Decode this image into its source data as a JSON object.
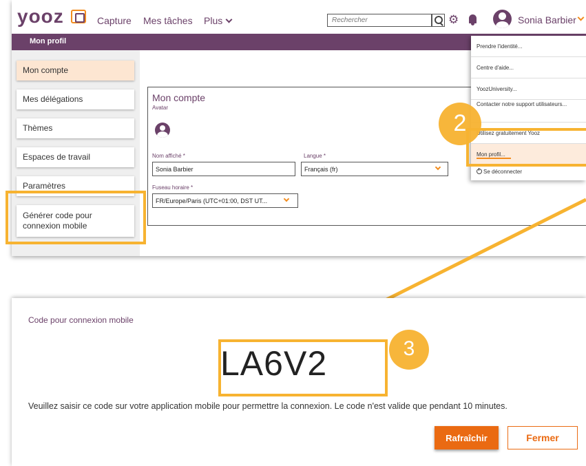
{
  "topnav": {
    "logo": "yooz",
    "links": [
      "Capture",
      "Mes tâches",
      "Plus"
    ],
    "search_placeholder": "Rechercher",
    "user_name": "Sonia Barbier"
  },
  "titlebar": {
    "title": "Mon profil"
  },
  "sidebar": {
    "items": [
      {
        "label": "Mon compte"
      },
      {
        "label": "Mes délégations"
      },
      {
        "label": "Thèmes"
      },
      {
        "label": "Espaces de travail"
      },
      {
        "label": "Paramètres"
      },
      {
        "label": "Générer code pour connexion mobile"
      }
    ]
  },
  "account": {
    "title": "Mon compte",
    "avatar_label": "Avatar",
    "display_name_label": "Nom affiché *",
    "display_name_value": "Sonia Barbier",
    "language_label": "Langue *",
    "language_value": "Français (fr)",
    "timezone_label": "Fuseau horaire *",
    "timezone_value": "FR/Europe/Paris (UTC+01:00, DST UT..."
  },
  "user_menu": {
    "items": [
      {
        "label": "Prendre l'identité..."
      },
      {
        "label": "Centre d'aide..."
      },
      {
        "label": "YoozUniversity..."
      },
      {
        "label": "Contacter notre support utilisateurs..."
      },
      {
        "label": "Utilisez gratuitement Yooz"
      },
      {
        "label": "Mon profil..."
      },
      {
        "label": "Se déconnecter"
      }
    ]
  },
  "steps": {
    "step2": "2",
    "step3": "3"
  },
  "mobile_code": {
    "title": "Code pour connexion mobile",
    "code": "LA6V2",
    "description": "Veuillez saisir ce code sur votre application mobile pour permettre la connexion. Le code n'est valide que pendant 10 minutes.",
    "refresh_label": "Rafraîchir",
    "close_label": "Fermer"
  },
  "colors": {
    "brand_purple": "#6b4169",
    "accent_orange": "#ea6a12",
    "highlight_yellow": "#f7b331"
  }
}
